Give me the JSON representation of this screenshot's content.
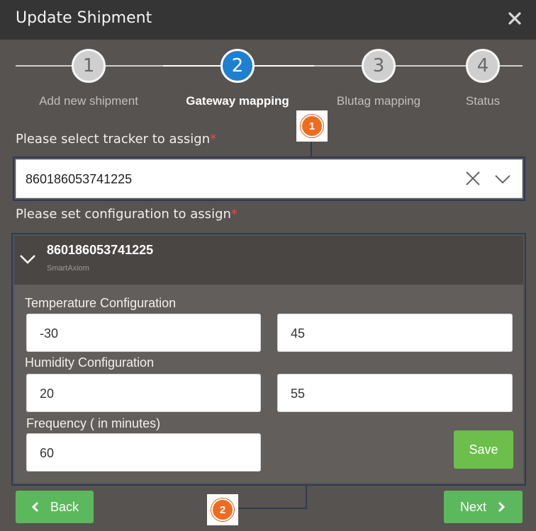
{
  "dialog": {
    "title": "Update Shipment",
    "close_icon": "close-icon"
  },
  "stepper": {
    "steps": [
      {
        "number": "1",
        "label": "Add new shipment",
        "state": "done"
      },
      {
        "number": "2",
        "label": "Gateway mapping",
        "state": "active"
      },
      {
        "number": "3",
        "label": "Blutag mapping",
        "state": "pending"
      },
      {
        "number": "4",
        "label": "Status",
        "state": "pending"
      }
    ]
  },
  "tracker": {
    "label": "Please select tracker to assign",
    "required_mark": "*",
    "value": "860186053741225"
  },
  "configuration": {
    "label": "Please set configuration to assign",
    "required_mark": "*",
    "device": {
      "id": "860186053741225",
      "vendor": "SmartAxiom"
    },
    "temperature": {
      "label": "Temperature Configuration",
      "min": "-30",
      "max": "45"
    },
    "humidity": {
      "label": "Humidity Configuration",
      "min": "20",
      "max": "55"
    },
    "frequency": {
      "label": "Frequency ( in minutes)",
      "value": "60"
    },
    "save_label": "Save"
  },
  "footer": {
    "back_label": "Back",
    "next_label": "Next"
  },
  "annotations": [
    {
      "number": "1"
    },
    {
      "number": "2"
    }
  ],
  "colors": {
    "accent": "#1f7fd1",
    "success": "#5cb85c",
    "required": "#e74c3c",
    "callout": "#f06b1f"
  }
}
